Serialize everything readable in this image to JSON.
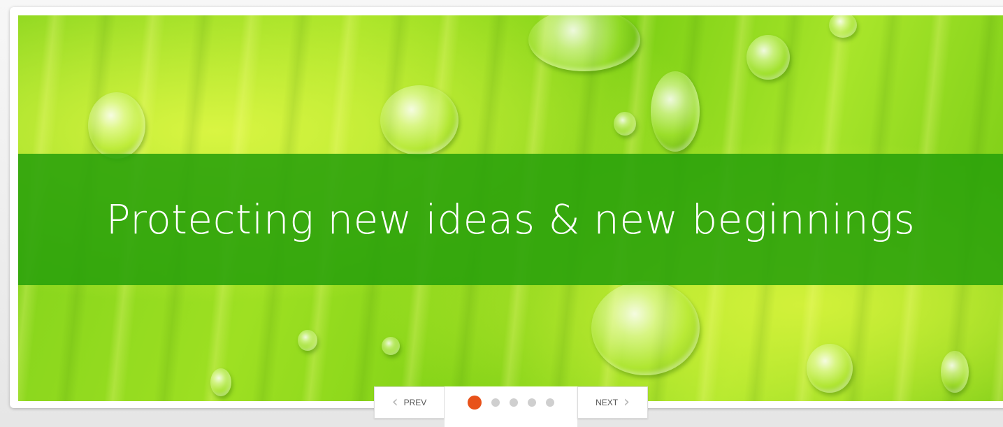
{
  "slider": {
    "caption": "Protecting new ideas & new beginnings",
    "active_slide": 1,
    "slide_count": 5
  },
  "pager": {
    "prev_label": "PREV",
    "next_label": "NEXT",
    "prev_icon": "chevron-left-icon",
    "next_icon": "chevron-right-icon"
  },
  "colors": {
    "banner": "#28a00a",
    "active_dot": "#e8521a",
    "inactive_dot": "#cfcfcf"
  }
}
